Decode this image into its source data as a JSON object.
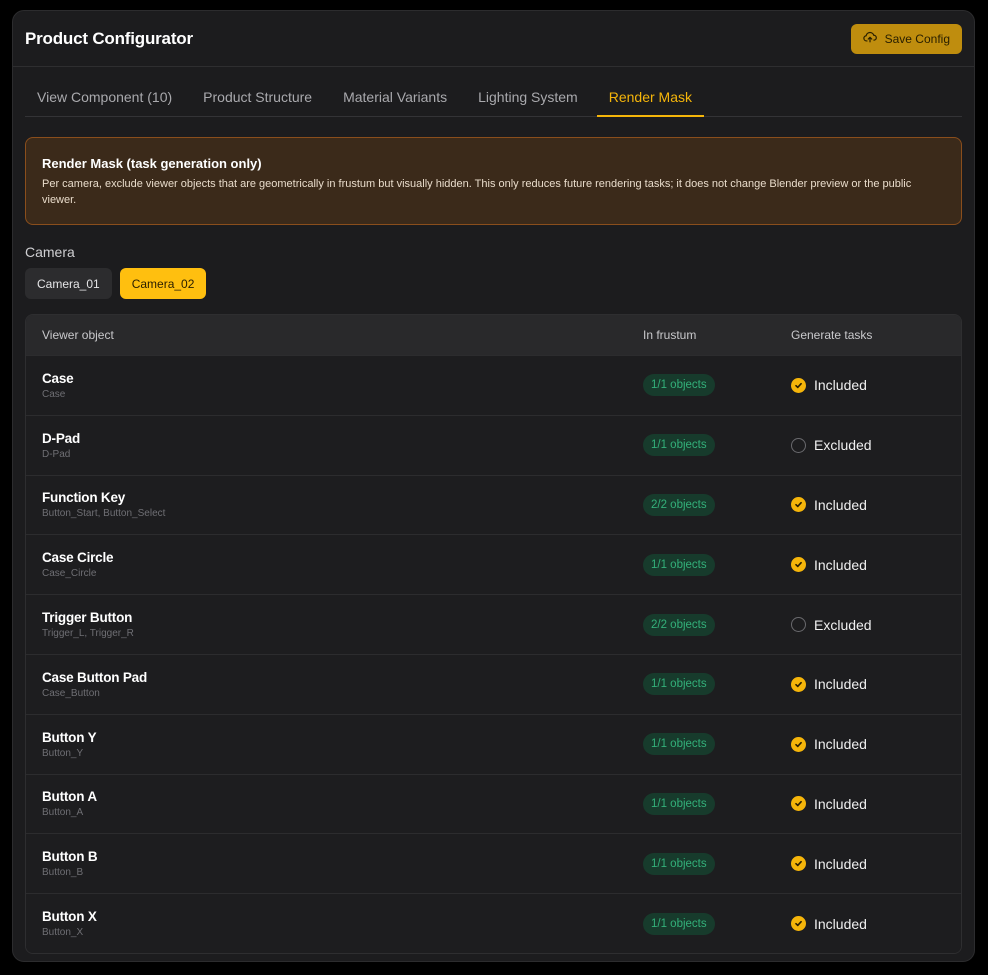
{
  "header": {
    "title": "Product Configurator",
    "save_label": "Save Config"
  },
  "tabs": [
    {
      "label": "View Component (10)",
      "active": false
    },
    {
      "label": "Product Structure",
      "active": false
    },
    {
      "label": "Material Variants",
      "active": false
    },
    {
      "label": "Lighting System",
      "active": false
    },
    {
      "label": "Render Mask",
      "active": true
    }
  ],
  "notice": {
    "title": "Render Mask (task generation only)",
    "text": "Per camera, exclude viewer objects that are geometrically in frustum but visually hidden. This only reduces future rendering tasks; it does not change Blender preview or the public viewer."
  },
  "camera": {
    "label": "Camera",
    "options": [
      {
        "label": "Camera_01",
        "active": false
      },
      {
        "label": "Camera_02",
        "active": true
      }
    ]
  },
  "table": {
    "headers": {
      "object": "Viewer object",
      "frustum": "In frustum",
      "generate": "Generate tasks"
    },
    "rows": [
      {
        "name": "Case",
        "sub": "Case",
        "frustum": "1/1 objects",
        "status": "Included",
        "included": true
      },
      {
        "name": "D-Pad",
        "sub": "D-Pad",
        "frustum": "1/1 objects",
        "status": "Excluded",
        "included": false
      },
      {
        "name": "Function Key",
        "sub": "Button_Start, Button_Select",
        "frustum": "2/2 objects",
        "status": "Included",
        "included": true
      },
      {
        "name": "Case Circle",
        "sub": "Case_Circle",
        "frustum": "1/1 objects",
        "status": "Included",
        "included": true
      },
      {
        "name": "Trigger Button",
        "sub": "Trigger_L, Trigger_R",
        "frustum": "2/2 objects",
        "status": "Excluded",
        "included": false
      },
      {
        "name": "Case Button Pad",
        "sub": "Case_Button",
        "frustum": "1/1 objects",
        "status": "Included",
        "included": true
      },
      {
        "name": "Button Y",
        "sub": "Button_Y",
        "frustum": "1/1 objects",
        "status": "Included",
        "included": true
      },
      {
        "name": "Button A",
        "sub": "Button_A",
        "frustum": "1/1 objects",
        "status": "Included",
        "included": true
      },
      {
        "name": "Button B",
        "sub": "Button_B",
        "frustum": "1/1 objects",
        "status": "Included",
        "included": true
      },
      {
        "name": "Button X",
        "sub": "Button_X",
        "frustum": "1/1 objects",
        "status": "Included",
        "included": true
      }
    ]
  },
  "colors": {
    "accent": "#f5b50a",
    "badge_bg": "#173b2c",
    "badge_text": "#33b07a",
    "notice_bg": "#3b2a1a",
    "notice_border": "#8a4e1c"
  },
  "icons": {
    "save": "cloud-upload-icon",
    "check": "check-icon"
  }
}
